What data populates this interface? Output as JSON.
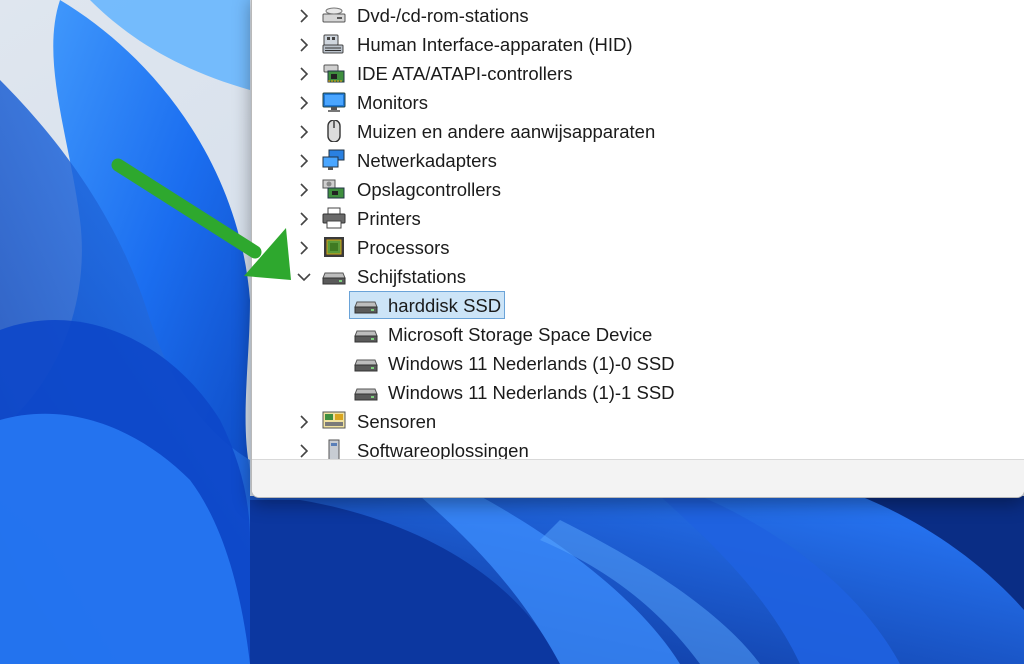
{
  "device_tree": {
    "categories": [
      {
        "label": "Dvd-/cd-rom-stations",
        "icon": "dvd-drive-icon",
        "expanded": false
      },
      {
        "label": "Human Interface-apparaten (HID)",
        "icon": "hid-keyboard-icon",
        "expanded": false
      },
      {
        "label": "IDE ATA/ATAPI-controllers",
        "icon": "ide-controller-icon",
        "expanded": false
      },
      {
        "label": "Monitors",
        "icon": "monitor-icon",
        "expanded": false
      },
      {
        "label": "Muizen en andere aanwijsapparaten",
        "icon": "mouse-icon",
        "expanded": false
      },
      {
        "label": "Netwerkadapters",
        "icon": "network-adapter-icon",
        "expanded": false
      },
      {
        "label": "Opslagcontrollers",
        "icon": "storage-controller-icon",
        "expanded": false
      },
      {
        "label": "Printers",
        "icon": "printer-icon",
        "expanded": false
      },
      {
        "label": "Processors",
        "icon": "processor-icon",
        "expanded": false
      },
      {
        "label": "Schijfstations",
        "icon": "disk-drive-icon",
        "expanded": true
      },
      {
        "label": "Sensoren",
        "icon": "sensor-icon",
        "expanded": false
      },
      {
        "label": "Softwareoplossingen",
        "icon": "software-component-icon",
        "expanded": false
      }
    ],
    "disk_devices": [
      {
        "label": "harddisk SSD",
        "selected": true
      },
      {
        "label": "Microsoft Storage Space Device",
        "selected": false
      },
      {
        "label": "Windows 11 Nederlands (1)-0 SSD",
        "selected": false
      },
      {
        "label": "Windows 11 Nederlands (1)-1 SSD",
        "selected": false
      }
    ]
  },
  "annotation": {
    "arrow_color": "#2ea82e"
  },
  "colors": {
    "selection_bg": "#cce4f7",
    "selection_border": "#6aa3d8",
    "wallpaper_blue": "#1f6fe8"
  }
}
